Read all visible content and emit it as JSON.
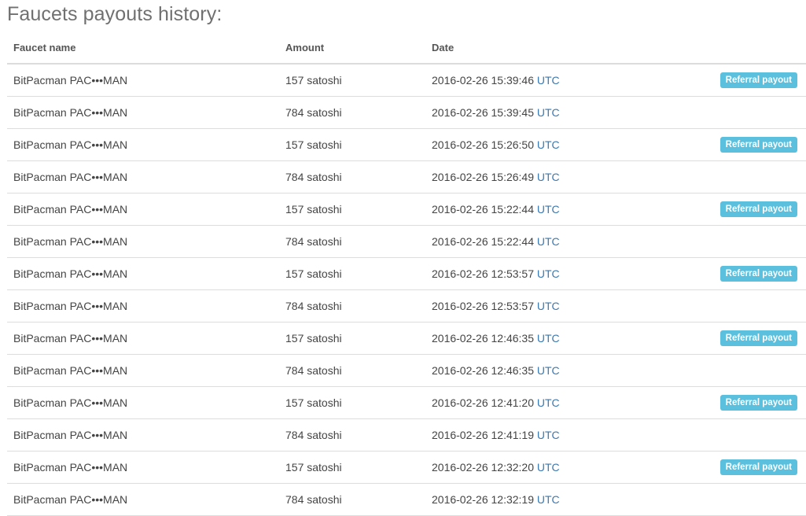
{
  "page_title": "Faucets payouts history:",
  "table": {
    "headers": {
      "name": "Faucet name",
      "amount": "Amount",
      "date": "Date"
    },
    "tz_label": "UTC",
    "rows": [
      {
        "name": "BitPacman PAC•••MAN",
        "amount": "157 satoshi",
        "date": "2016-02-26 15:39:46",
        "badge": "Referral payout"
      },
      {
        "name": "BitPacman PAC•••MAN",
        "amount": "784 satoshi",
        "date": "2016-02-26 15:39:45",
        "badge": ""
      },
      {
        "name": "BitPacman PAC•••MAN",
        "amount": "157 satoshi",
        "date": "2016-02-26 15:26:50",
        "badge": "Referral payout"
      },
      {
        "name": "BitPacman PAC•••MAN",
        "amount": "784 satoshi",
        "date": "2016-02-26 15:26:49",
        "badge": ""
      },
      {
        "name": "BitPacman PAC•••MAN",
        "amount": "157 satoshi",
        "date": "2016-02-26 15:22:44",
        "badge": "Referral payout"
      },
      {
        "name": "BitPacman PAC•••MAN",
        "amount": "784 satoshi",
        "date": "2016-02-26 15:22:44",
        "badge": ""
      },
      {
        "name": "BitPacman PAC•••MAN",
        "amount": "157 satoshi",
        "date": "2016-02-26 12:53:57",
        "badge": "Referral payout"
      },
      {
        "name": "BitPacman PAC•••MAN",
        "amount": "784 satoshi",
        "date": "2016-02-26 12:53:57",
        "badge": ""
      },
      {
        "name": "BitPacman PAC•••MAN",
        "amount": "157 satoshi",
        "date": "2016-02-26 12:46:35",
        "badge": "Referral payout"
      },
      {
        "name": "BitPacman PAC•••MAN",
        "amount": "784 satoshi",
        "date": "2016-02-26 12:46:35",
        "badge": ""
      },
      {
        "name": "BitPacman PAC•••MAN",
        "amount": "157 satoshi",
        "date": "2016-02-26 12:41:20",
        "badge": "Referral payout"
      },
      {
        "name": "BitPacman PAC•••MAN",
        "amount": "784 satoshi",
        "date": "2016-02-26 12:41:19",
        "badge": ""
      },
      {
        "name": "BitPacman PAC•••MAN",
        "amount": "157 satoshi",
        "date": "2016-02-26 12:32:20",
        "badge": "Referral payout"
      },
      {
        "name": "BitPacman PAC•••MAN",
        "amount": "784 satoshi",
        "date": "2016-02-26 12:32:19",
        "badge": ""
      }
    ]
  },
  "colors": {
    "badge_bg": "#5bc0de",
    "timezone_link": "#3a79b2",
    "title": "#707070"
  }
}
